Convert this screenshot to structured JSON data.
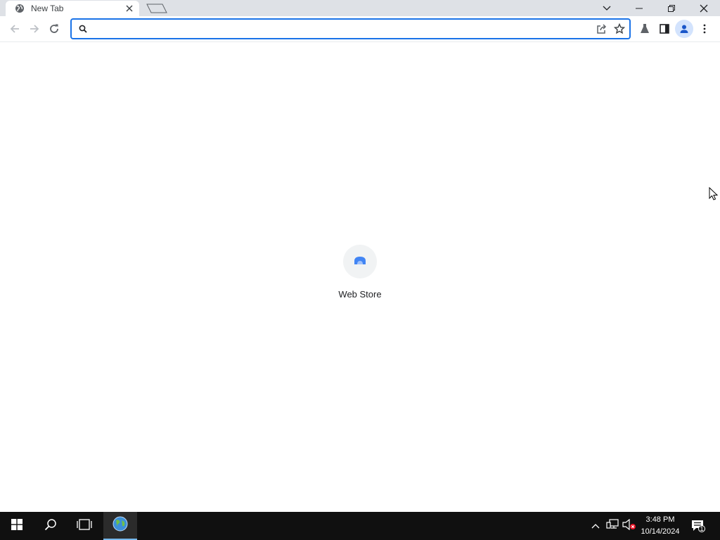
{
  "browser": {
    "tab": {
      "title": "New Tab",
      "favicon": "globe-icon"
    },
    "window_controls": [
      "tab-search-icon",
      "minimize-icon",
      "restore-icon",
      "close-icon"
    ]
  },
  "toolbar": {
    "omnibox": {
      "value": "",
      "placeholder": ""
    }
  },
  "page": {
    "shortcuts": [
      {
        "label": "Web Store",
        "icon": "web-store-icon"
      }
    ]
  },
  "taskbar": {
    "time": "3:48 PM",
    "date": "10/14/2024",
    "notification_count": "1"
  },
  "colors": {
    "accent": "#1a73e8",
    "tabstrip": "#dee1e6",
    "taskbar": "#101010"
  }
}
